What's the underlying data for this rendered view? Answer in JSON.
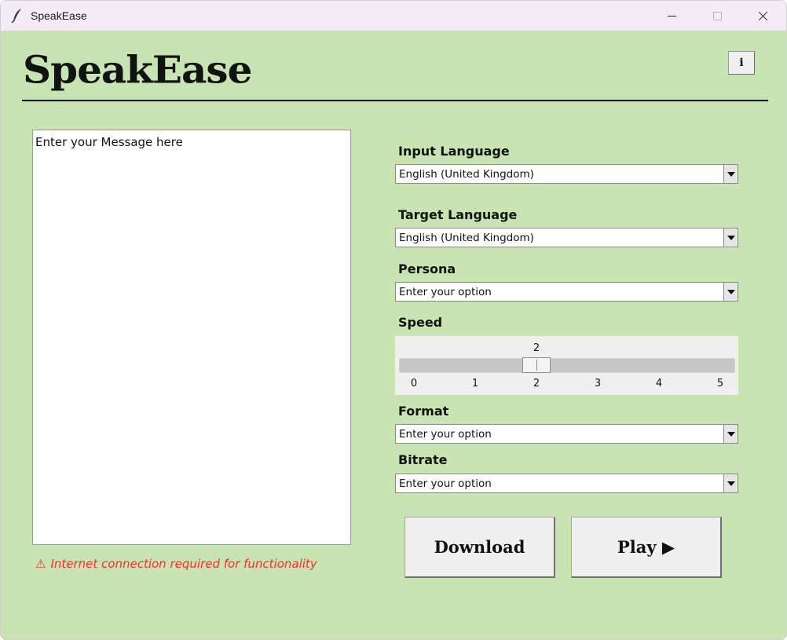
{
  "window": {
    "title": "SpeakEase",
    "app_icon": "feather-icon"
  },
  "header": {
    "logo": "SpeakEase",
    "info_label": "i"
  },
  "message": {
    "placeholder": "Enter your Message here"
  },
  "warning": {
    "icon": "⚠",
    "text": "Internet connection required for functionality",
    "color": "#ff2a2a"
  },
  "fields": {
    "input_language": {
      "label": "Input Language",
      "value": "English (United Kingdom)"
    },
    "target_language": {
      "label": "Target Language",
      "value": "English (United Kingdom)"
    },
    "persona": {
      "label": "Persona",
      "value": "Enter your option"
    },
    "format": {
      "label": "Format",
      "value": "Enter your option"
    },
    "bitrate": {
      "label": "Bitrate",
      "value": "Enter your option"
    }
  },
  "speed": {
    "label": "Speed",
    "value": 2,
    "min": 0,
    "max": 5,
    "ticks": [
      "0",
      "1",
      "2",
      "3",
      "4",
      "5"
    ]
  },
  "buttons": {
    "download": "Download",
    "play": "Play ▶"
  },
  "colors": {
    "background": "#c7e4b2",
    "titlebar": "#f3ebf6",
    "warning": "#ff2a2a"
  }
}
